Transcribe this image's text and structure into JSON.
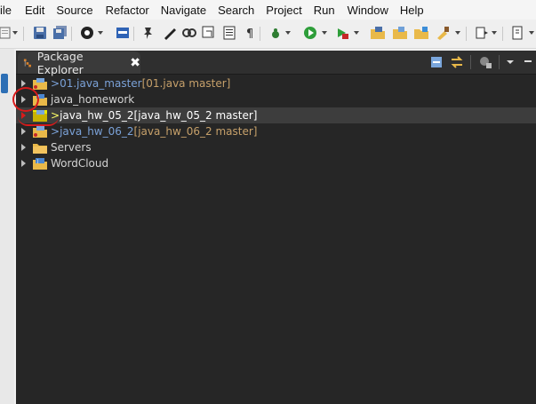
{
  "menu": {
    "items": [
      "ile",
      "Edit",
      "Source",
      "Refactor",
      "Navigate",
      "Search",
      "Project",
      "Run",
      "Window",
      "Help"
    ]
  },
  "toolbar": {
    "icons": [
      "new-icon",
      "save-icon",
      "save-all-icon",
      "debug-target-icon",
      "console-icon",
      "pin-icon",
      "pencil-icon",
      "link-icon",
      "open-type-icon",
      "show-whitespace-icon",
      "bug-icon",
      "run-icon",
      "external-tools-icon",
      "new-package-icon",
      "open-folder-icon",
      "new-folder-icon",
      "paintbrush-icon",
      "search-next-icon",
      "navigate-icon"
    ]
  },
  "panel": {
    "tab_title": "Package Explorer",
    "tab_close": "✖"
  },
  "tree": {
    "items": [
      {
        "prefix": "> ",
        "name": "01.java_master",
        "git": " [01.java master]",
        "color": "#7ba2d8"
      },
      {
        "prefix": "",
        "name": "java_homework",
        "git": "",
        "color": "#d4d4d4"
      },
      {
        "prefix": "> ",
        "name": "java_hw_05_2",
        "git": " [java_hw_05_2 master]",
        "color": "#ffffff"
      },
      {
        "prefix": "> ",
        "name": "java_hw_06_2",
        "git": " [java_hw_06_2 master]",
        "color": "#7ba2d8"
      },
      {
        "prefix": "",
        "name": "Servers",
        "git": "",
        "color": "#d4d4d4"
      },
      {
        "prefix": "",
        "name": "WordCloud",
        "git": "",
        "color": "#d4d4d4"
      }
    ]
  },
  "colors": {
    "panel_bg": "#262626",
    "git_decoration": "#c6a06a",
    "annotation_red": "#d81b1b",
    "selected_highlight": "#e8e800"
  }
}
